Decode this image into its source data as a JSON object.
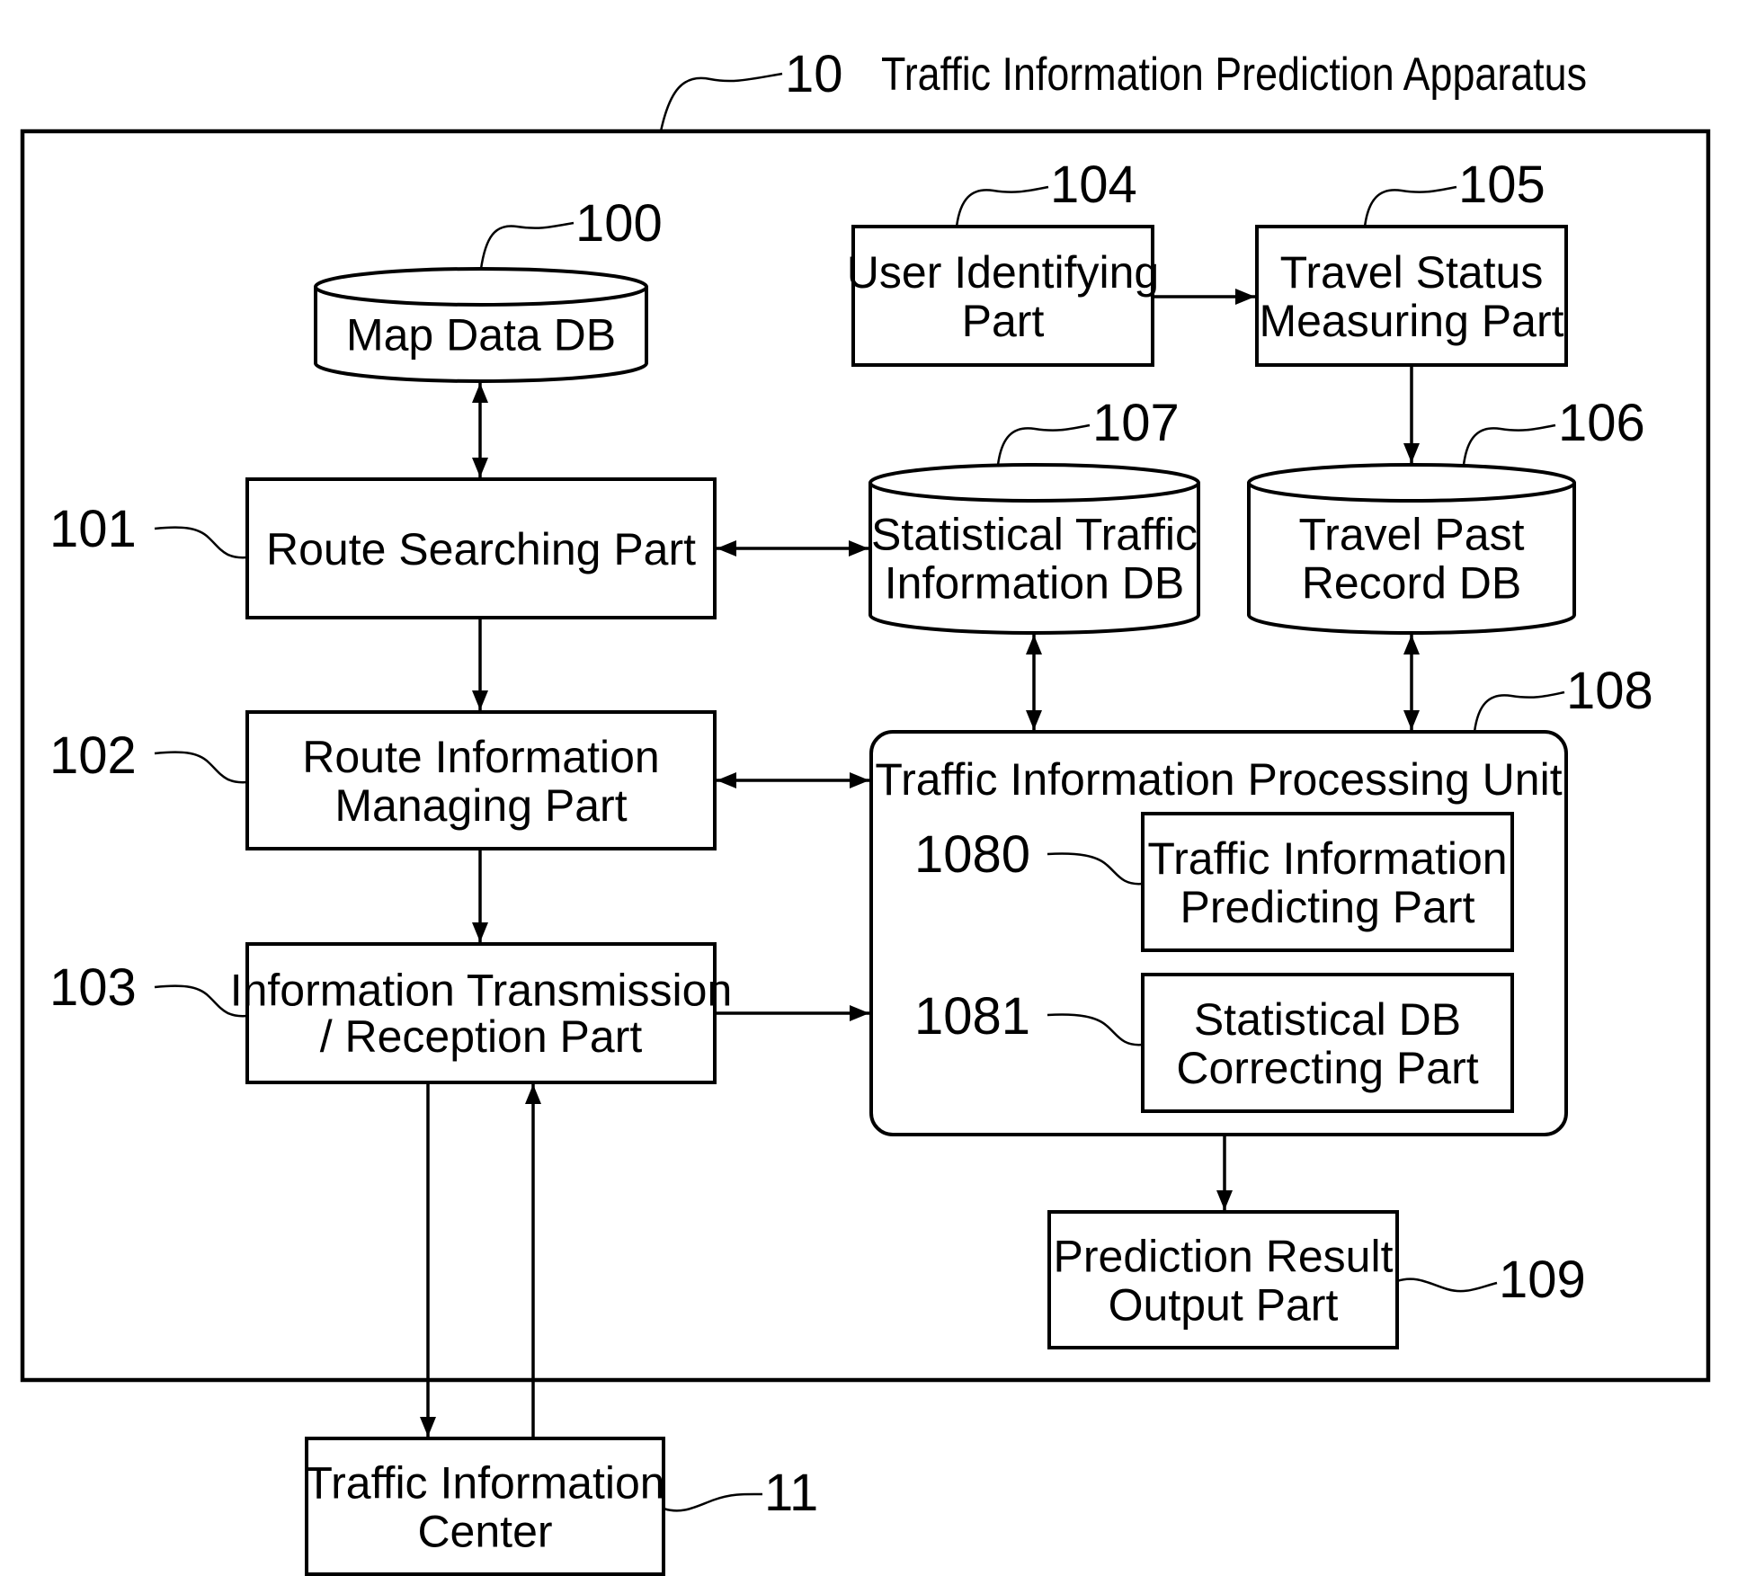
{
  "diagram": {
    "apparatus": {
      "ref": "10",
      "title": "Traffic Information Prediction Apparatus"
    },
    "nodes": {
      "map_db": {
        "ref": "100",
        "lines": [
          "Map Data DB"
        ],
        "shape": "database"
      },
      "route_search": {
        "ref": "101",
        "lines": [
          "Route Searching Part"
        ],
        "shape": "box"
      },
      "route_manage": {
        "ref": "102",
        "lines": [
          "Route Information",
          "Managing Part"
        ],
        "shape": "box"
      },
      "trans_recep": {
        "ref": "103",
        "lines": [
          "Information Transmission",
          "/ Reception Part"
        ],
        "shape": "box"
      },
      "user_ident": {
        "ref": "104",
        "lines": [
          "User Identifying",
          "Part"
        ],
        "shape": "box"
      },
      "travel_status": {
        "ref": "105",
        "lines": [
          "Travel Status",
          "Measuring Part"
        ],
        "shape": "box"
      },
      "travel_past_db": {
        "ref": "106",
        "lines": [
          "Travel Past",
          "Record DB"
        ],
        "shape": "database"
      },
      "stat_db": {
        "ref": "107",
        "lines": [
          "Statistical Traffic",
          "Information DB"
        ],
        "shape": "database"
      },
      "tipu": {
        "ref": "108",
        "lines": [
          "Traffic Information Processing Unit"
        ],
        "shape": "rounded-box"
      },
      "predicting": {
        "ref": "1080",
        "lines": [
          "Traffic Information",
          "Predicting Part"
        ],
        "shape": "box"
      },
      "correcting": {
        "ref": "1081",
        "lines": [
          "Statistical DB",
          "Correcting Part"
        ],
        "shape": "box"
      },
      "pred_output": {
        "ref": "109",
        "lines": [
          "Prediction Result",
          "Output Part"
        ],
        "shape": "box"
      },
      "tic": {
        "ref": "11",
        "lines": [
          "Traffic Information",
          "Center"
        ],
        "shape": "box"
      }
    },
    "edges": [
      {
        "from": "map_db",
        "to": "route_search",
        "direction": "both"
      },
      {
        "from": "route_search",
        "to": "stat_db",
        "direction": "both"
      },
      {
        "from": "route_search",
        "to": "route_manage",
        "direction": "forward"
      },
      {
        "from": "route_manage",
        "to": "tipu",
        "direction": "both"
      },
      {
        "from": "route_manage",
        "to": "trans_recep",
        "direction": "forward"
      },
      {
        "from": "trans_recep",
        "to": "tipu",
        "direction": "forward"
      },
      {
        "from": "trans_recep",
        "to": "tic",
        "direction": "forward"
      },
      {
        "from": "tic",
        "to": "trans_recep",
        "direction": "forward"
      },
      {
        "from": "user_ident",
        "to": "travel_status",
        "direction": "forward"
      },
      {
        "from": "travel_status",
        "to": "travel_past_db",
        "direction": "forward"
      },
      {
        "from": "stat_db",
        "to": "tipu",
        "direction": "both"
      },
      {
        "from": "travel_past_db",
        "to": "tipu",
        "direction": "both"
      },
      {
        "from": "tipu",
        "to": "pred_output",
        "direction": "forward"
      }
    ]
  }
}
